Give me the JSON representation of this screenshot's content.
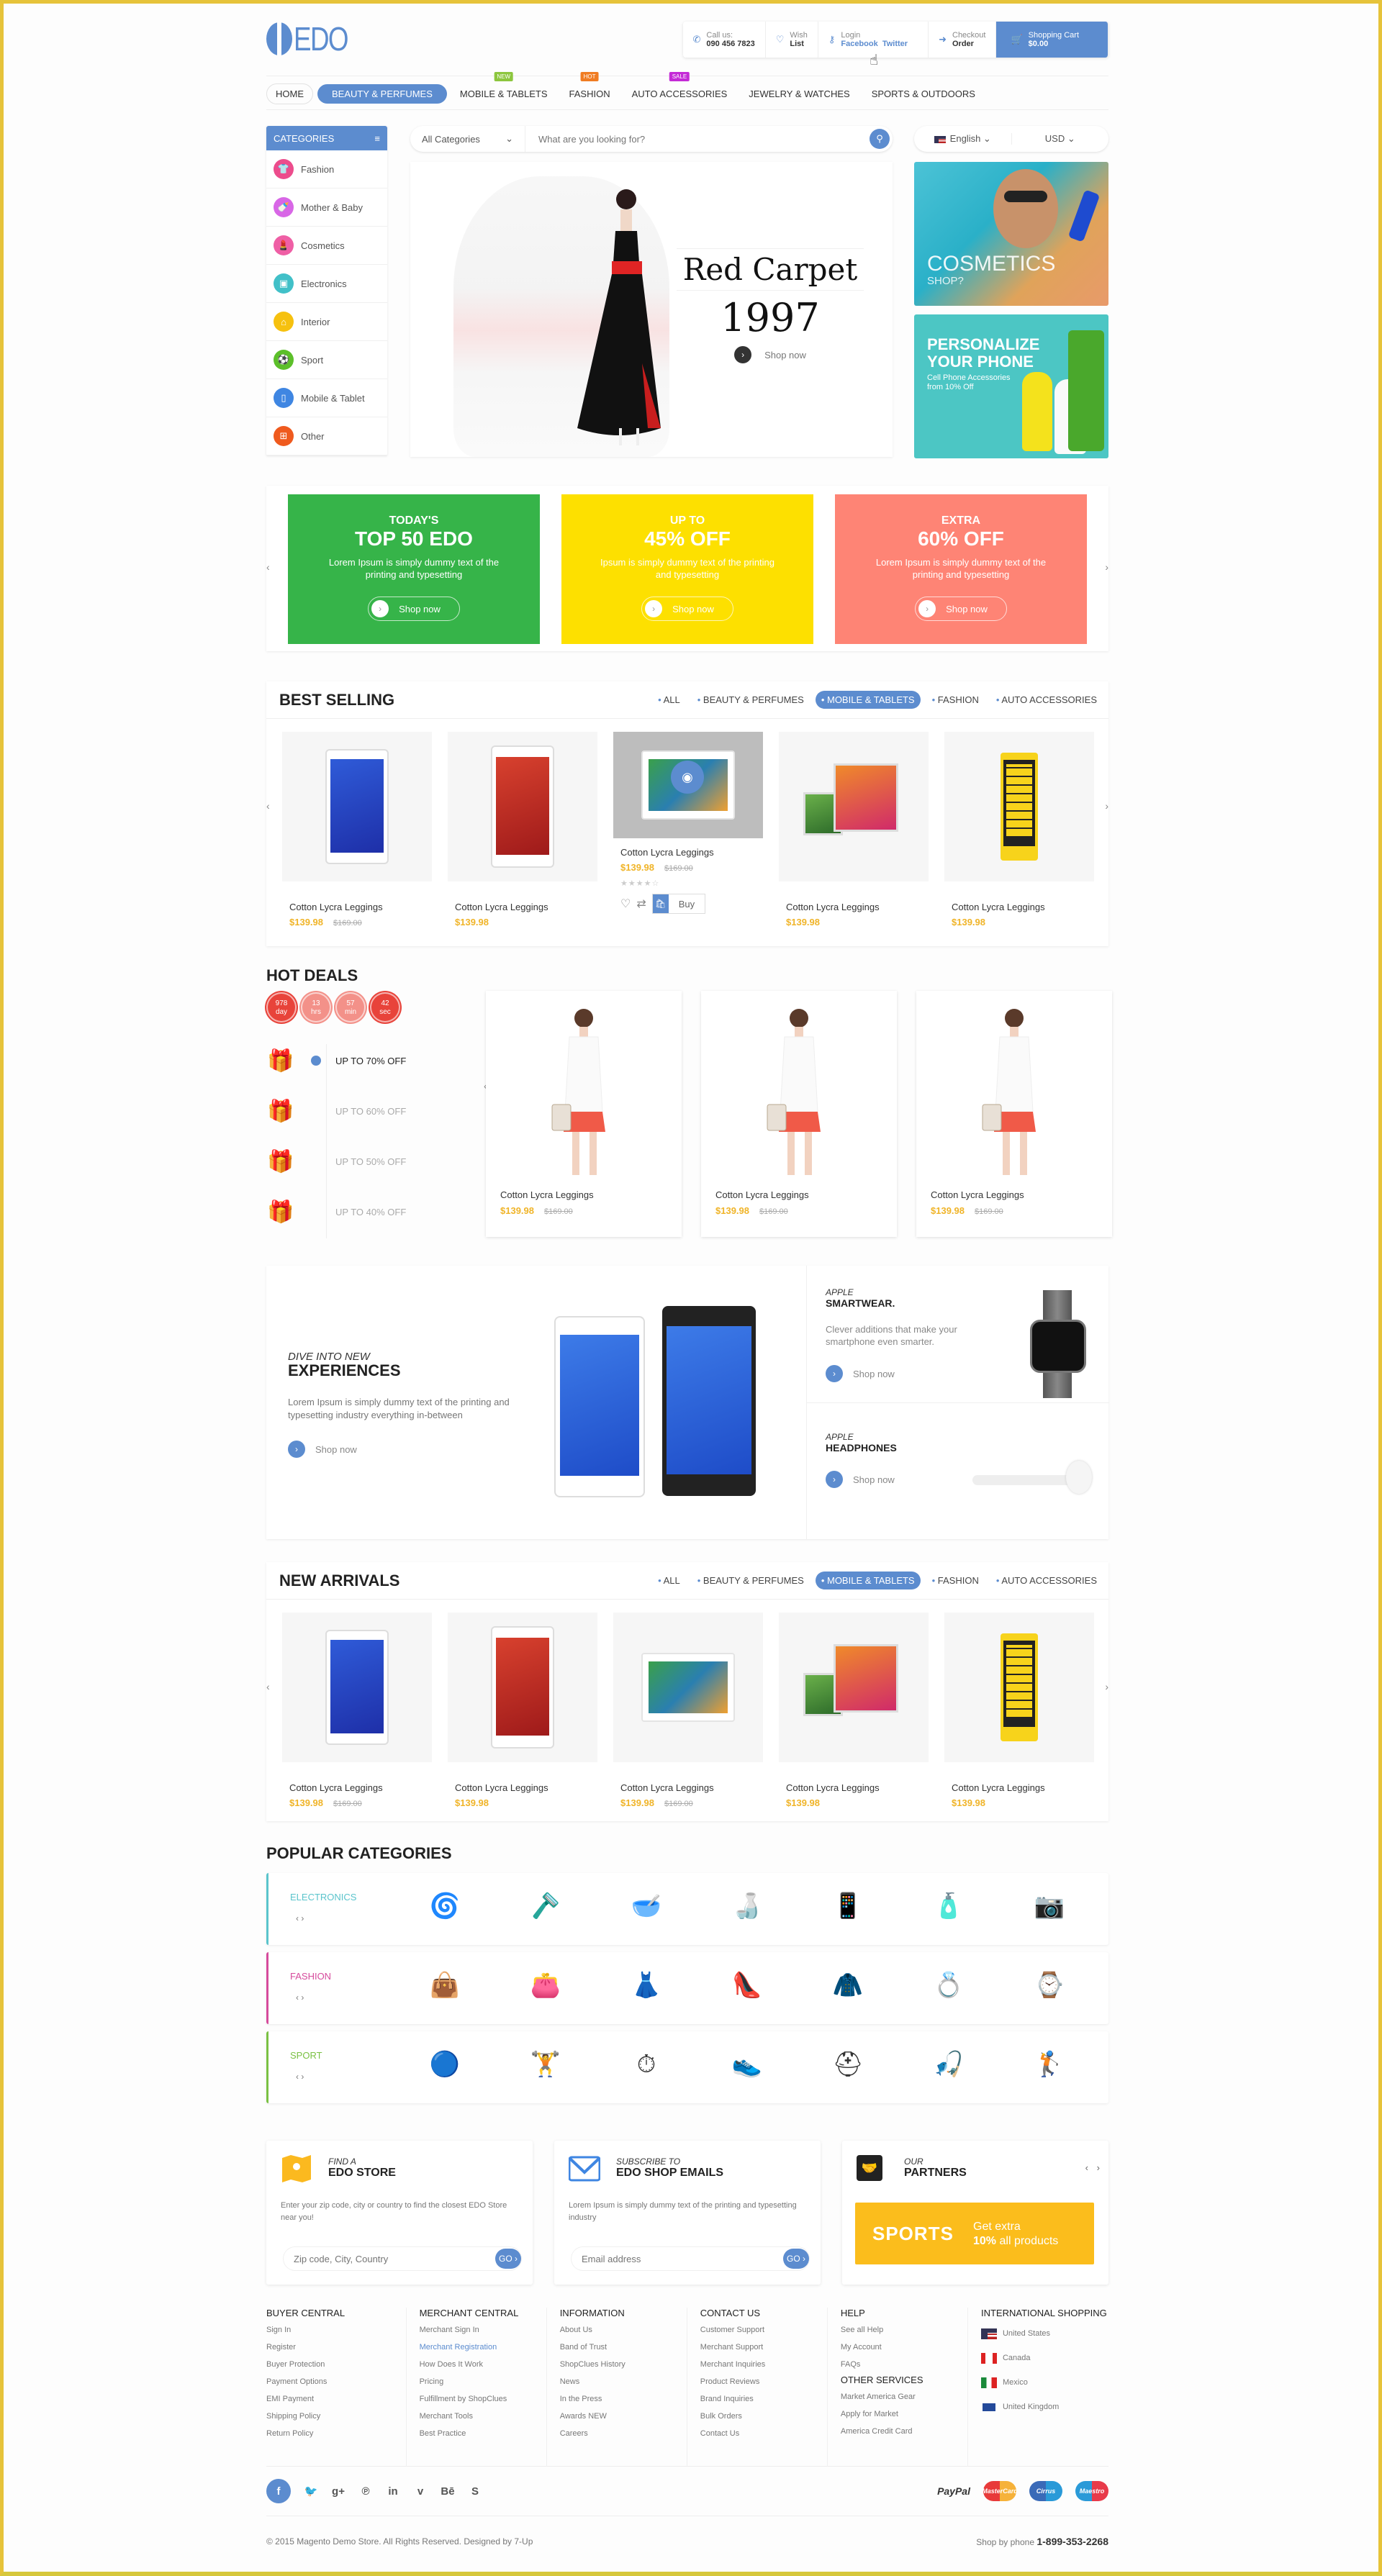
{
  "brand": {
    "name": "EDO",
    "color": "#5c8ccf"
  },
  "header": {
    "call": {
      "label": "Call us:",
      "value": "090 456 7823",
      "icon": "phone-icon"
    },
    "wish": {
      "label": "Wish",
      "value": "List",
      "icon": "heart-icon"
    },
    "login": {
      "label": "Login",
      "facebook": "Facebook",
      "twitter": "Twitter",
      "icon": "key-icon"
    },
    "checkout": {
      "label": "Checkout",
      "value": "Order",
      "icon": "arrow-circle-icon"
    },
    "cart": {
      "label": "Shopping Cart",
      "value": "$0.00",
      "icon": "cart-icon"
    }
  },
  "nav": {
    "items": [
      {
        "label": "HOME"
      },
      {
        "label": "BEAUTY & PERFUMES",
        "active": true
      },
      {
        "label": "MOBILE & TABLETS",
        "badge": "NEW",
        "badge_color": "#8cc63e"
      },
      {
        "label": "FASHION",
        "badge": "HOT",
        "badge_color": "#f07c22"
      },
      {
        "label": "AUTO ACCESSORIES",
        "badge": "SALE",
        "badge_color": "#c42bd6"
      },
      {
        "label": "JEWELRY & WATCHES"
      },
      {
        "label": "SPORTS & OUTDOORS"
      }
    ]
  },
  "categories": {
    "title": "CATEGORIES",
    "items": [
      {
        "label": "Fashion",
        "color": "#ec4c8c",
        "icon": "shirt-icon"
      },
      {
        "label": "Mother & Baby",
        "color": "#d867e6",
        "icon": "bottle-icon"
      },
      {
        "label": "Cosmetics",
        "color": "#ef5fa5",
        "icon": "lipstick-icon"
      },
      {
        "label": "Electronics",
        "color": "#41c0c8",
        "icon": "chip-icon"
      },
      {
        "label": "Interior",
        "color": "#f6c10f",
        "icon": "sofa-icon"
      },
      {
        "label": "Sport",
        "color": "#5cbf2a",
        "icon": "ball-icon"
      },
      {
        "label": "Mobile & Tablet",
        "color": "#3f86e2",
        "icon": "mobile-icon"
      },
      {
        "label": "Other",
        "color": "#ef5a1e",
        "icon": "grid-icon"
      }
    ]
  },
  "search": {
    "category": "All Categories",
    "placeholder": "What are you looking for?"
  },
  "locale": {
    "language": "English",
    "currency": "USD"
  },
  "slider": {
    "title": "Red Carpet",
    "year": "1997",
    "cta": "Shop now"
  },
  "side_banners": [
    {
      "title": "COSMETICS",
      "subtitle": "SHOP?"
    },
    {
      "title_line1": "PERSONALIZE",
      "title_line2": "YOUR PHONE",
      "subtitle": "Cell Phone Accessories from 10% Off"
    }
  ],
  "promos": [
    {
      "kicker": "TODAY'S",
      "headline": "TOP 50 EDO",
      "text": "Lorem Ipsum is simply dummy text of the printing and typesetting",
      "cta": "Shop now",
      "color": "#36b449"
    },
    {
      "kicker": "UP TO",
      "headline": "45% OFF",
      "text": "Ipsum is simply dummy text of the printing and typesetting",
      "cta": "Shop now",
      "color": "#fde000"
    },
    {
      "kicker": "EXTRA",
      "headline": "60% OFF",
      "text": "Lorem Ipsum is simply dummy text of the printing and typesetting",
      "cta": "Shop now",
      "color": "#fe8475"
    }
  ],
  "filter_tabs": [
    "ALL",
    "BEAUTY & PERFUMES",
    "MOBILE & TABLETS",
    "FASHION",
    "AUTO ACCESSORIES"
  ],
  "best_selling": {
    "title": "BEST SELLING",
    "active_tab": "MOBILE & TABLETS",
    "products": [
      {
        "name": "Cotton Lycra Leggings",
        "price": "$139.98",
        "old_price": "$169.00"
      },
      {
        "name": "Cotton Lycra Leggings",
        "price": "$139.98"
      },
      {
        "name": "Cotton Lycra Leggings",
        "price": "$139.98",
        "old_price": "$169.00",
        "rating": 4,
        "buy": "Buy"
      },
      {
        "name": "Cotton Lycra Leggings",
        "price": "$139.98"
      },
      {
        "name": "Cotton Lycra Leggings",
        "price": "$139.98"
      }
    ]
  },
  "hot_deals": {
    "title": "HOT DEALS",
    "countdown": [
      {
        "value": "978",
        "unit": "day"
      },
      {
        "value": "13",
        "unit": "hrs"
      },
      {
        "value": "57",
        "unit": "min"
      },
      {
        "value": "42",
        "unit": "sec"
      }
    ],
    "tiers": [
      "UP TO 70% OFF",
      "UP TO 60% OFF",
      "UP TO 50% OFF",
      "UP TO 40% OFF"
    ],
    "products": [
      {
        "name": "Cotton Lycra Leggings",
        "price": "$139.98",
        "old_price": "$169.00"
      },
      {
        "name": "Cotton Lycra Leggings",
        "price": "$139.98",
        "old_price": "$169.00"
      },
      {
        "name": "Cotton Lycra Leggings",
        "price": "$139.98",
        "old_price": "$169.00"
      }
    ]
  },
  "feature": {
    "kicker": "DIVE INTO NEW",
    "title": "EXPERIENCES",
    "text": "Lorem Ipsum is simply dummy text of the printing and typesetting industry everything in-between",
    "cta": "Shop now",
    "smartwear": {
      "kicker": "APPLE",
      "title": "SMARTWEAR.",
      "text": "Clever additions that make your smartphone even smarter.",
      "cta": "Shop now"
    },
    "headphones": {
      "kicker": "APPLE",
      "title": "HEADPHONES",
      "cta": "Shop now"
    }
  },
  "new_arrivals": {
    "title": "NEW ARRIVALS",
    "active_tab": "MOBILE & TABLETS",
    "products": [
      {
        "name": "Cotton Lycra Leggings",
        "price": "$139.98",
        "old_price": "$169.00"
      },
      {
        "name": "Cotton Lycra Leggings",
        "price": "$139.98"
      },
      {
        "name": "Cotton Lycra Leggings",
        "price": "$139.98",
        "old_price": "$169.00"
      },
      {
        "name": "Cotton Lycra Leggings",
        "price": "$139.98"
      },
      {
        "name": "Cotton Lycra Leggings",
        "price": "$139.98"
      }
    ]
  },
  "popular": {
    "title": "POPULAR CATEGORIES",
    "rows": [
      {
        "label": "ELECTRONICS",
        "color": "#5ac4cc",
        "items": [
          "fan",
          "shaver",
          "mixer",
          "stand-mixer",
          "phone",
          "heater",
          "camera"
        ]
      },
      {
        "label": "FASHION",
        "color": "#d64b9c",
        "items": [
          "handbag",
          "clutch",
          "skirt",
          "heels",
          "jacket",
          "rings",
          "watch"
        ]
      },
      {
        "label": "SPORT",
        "color": "#7ac143",
        "items": [
          "ball-chair",
          "bench",
          "sport-watch",
          "sneaker",
          "helmet",
          "reel",
          "golf-club"
        ]
      }
    ]
  },
  "store_box": {
    "kicker": "FIND A",
    "title": "EDO STORE",
    "text": "Enter your zip code, city or country to find the closest EDO Store near you!",
    "placeholder": "Zip code, City, Country",
    "go": "GO ›"
  },
  "email_box": {
    "kicker": "SUBSCRIBE TO",
    "title": "EDO SHOP EMAILS",
    "text": "Lorem Ipsum is simply dummy text of the printing and typesetting industry",
    "placeholder": "Email address",
    "go": "GO ›"
  },
  "partners_box": {
    "kicker": "OUR",
    "title": "PARTNERS",
    "logo": "SPORTS",
    "offer_line1": "Get extra",
    "offer_bold": "10%",
    "offer_rest": "all products"
  },
  "footer": {
    "columns": [
      {
        "title": "BUYER CENTRAL",
        "links": [
          "Sign In",
          "Register",
          "Buyer Protection",
          "Payment Options",
          "EMI Payment",
          "Shipping Policy",
          "Return Policy"
        ]
      },
      {
        "title": "MERCHANT CENTRAL",
        "links": [
          "Merchant Sign In",
          "Merchant Registration",
          "How Does It Work",
          "Pricing",
          "Fulfillment by ShopClues",
          "Merchant Tools",
          "Best Practice"
        ]
      },
      {
        "title": "INFORMATION",
        "links": [
          "About Us",
          "Band of Trust",
          "ShopClues History",
          "News",
          "In the Press",
          "Awards NEW",
          "Careers"
        ]
      },
      {
        "title": "CONTACT US",
        "links": [
          "Customer Support",
          "Merchant Support",
          "Merchant Inquiries",
          "Product Reviews",
          "Brand Inquiries",
          "Bulk Orders",
          "Contact Us"
        ]
      },
      {
        "title": "HELP",
        "links": [
          "See all Help",
          "My Account",
          "FAQs"
        ],
        "title2": "OTHER SERVICES",
        "links2": [
          "Market America Gear",
          "Apply for Market",
          "America Credit Card"
        ]
      },
      {
        "title": "INTERNATIONAL SHOPPING",
        "countries": [
          "United States",
          "Canada",
          "Mexico",
          "United Kingdom"
        ]
      }
    ],
    "social": [
      "facebook",
      "twitter",
      "google-plus",
      "pinterest",
      "linkedin",
      "vimeo",
      "behance",
      "skype"
    ],
    "payments": [
      "PayPal",
      "MasterCard",
      "Cirrus",
      "Maestro"
    ],
    "copyright": "© 2015 Magento Demo Store. All Rights Reserved. Designed by 7-Up",
    "phone_label": "Shop by phone",
    "phone": "1-899-353-2268"
  }
}
